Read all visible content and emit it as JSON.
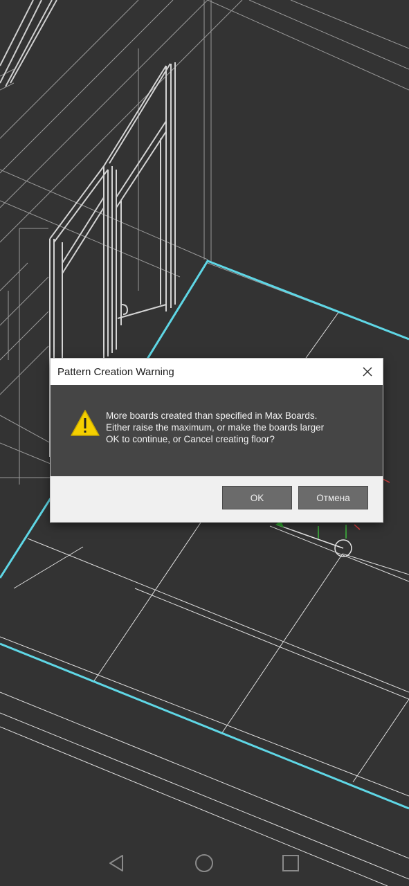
{
  "dialog": {
    "title": "Pattern Creation Warning",
    "message_lines": [
      "More boards created than specified in Max Boards.",
      "Either raise the maximum, or make the boards larger",
      "OK to continue, or Cancel creating floor?"
    ],
    "ok_label": "OK",
    "cancel_label": "Отмена",
    "icon": "warning-icon"
  },
  "navbar": {
    "back_icon": "back-triangle-icon",
    "home_icon": "home-circle-icon",
    "recent_icon": "recent-apps-square-icon"
  },
  "colors": {
    "viewport_bg": "#333333",
    "wire": "#d9d9d9",
    "floor_edge": "#5fd7e6",
    "dialog_content_bg": "#454545",
    "button_bg": "#6b6b6b",
    "warning_yellow": "#f5d000"
  }
}
